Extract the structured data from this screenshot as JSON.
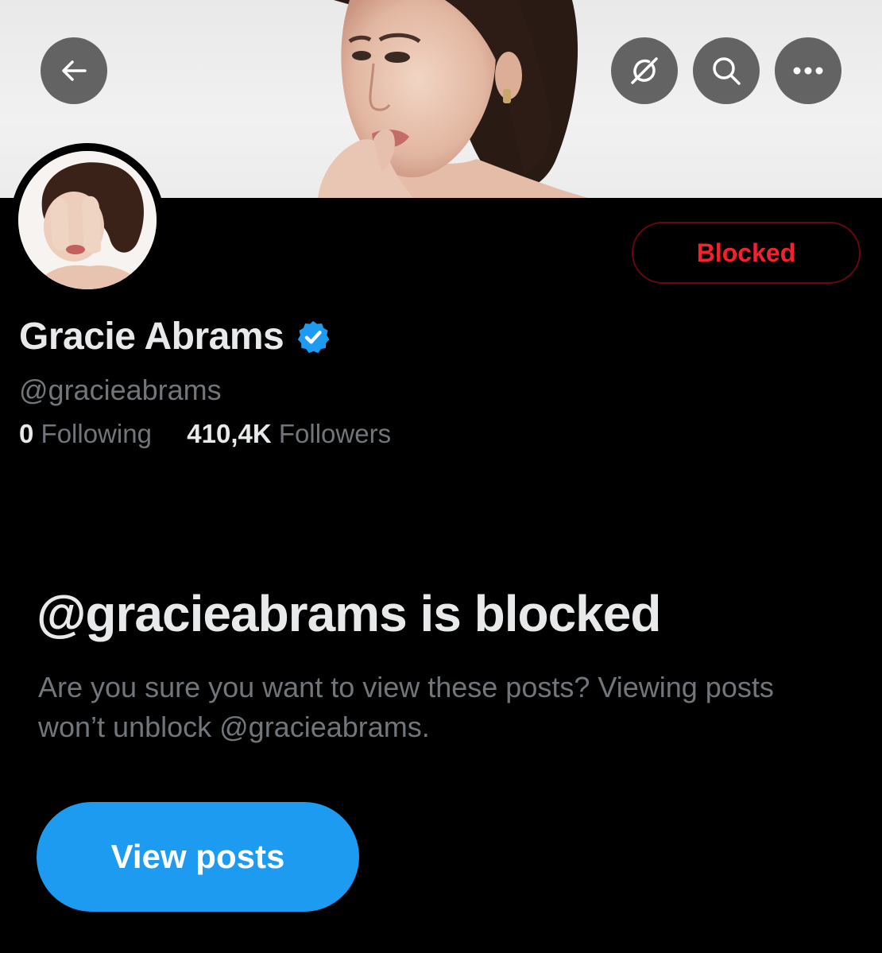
{
  "header": {
    "back_icon": "arrow-left-icon",
    "grok_icon": "grok-icon",
    "search_icon": "search-icon",
    "more_icon": "more-horizontal-icon"
  },
  "profile": {
    "blocked_label": "Blocked",
    "name": "Gracie Abrams",
    "verified_icon": "verified-badge-icon",
    "handle": "@gracieabrams",
    "following_count": "0",
    "following_label": "Following",
    "followers_count": "410,4K",
    "followers_label": "Followers"
  },
  "blocked_notice": {
    "title": "@gracieabrams is blocked",
    "description": "Are you sure you want to view these posts? Viewing posts won’t unblock @gracieabrams.",
    "button_label": "View posts"
  },
  "colors": {
    "background": "#000000",
    "accent_blue": "#1d9bf0",
    "blocked_red": "#f4212e",
    "secondary_text": "#71767b",
    "primary_text": "#e7e9ea"
  }
}
